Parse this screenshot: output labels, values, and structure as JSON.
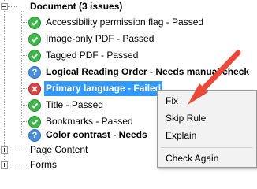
{
  "tree": {
    "root_partial_label": "s",
    "document_node": {
      "label": "Document (3 issues)",
      "expanded": true
    },
    "checks": [
      {
        "label": "Accessibility permission flag - Passed",
        "status": "passed",
        "bold": false
      },
      {
        "label": "Image-only PDF - Passed",
        "status": "passed",
        "bold": false
      },
      {
        "label": "Tagged PDF - Passed",
        "status": "passed",
        "bold": false
      },
      {
        "label": "Logical Reading Order - Needs manual check",
        "status": "needs-check",
        "bold": true
      },
      {
        "label": "Primary language - Failed",
        "status": "failed",
        "bold": true,
        "selected": true
      },
      {
        "label": "Title - Passed",
        "status": "passed",
        "bold": false
      },
      {
        "label": "Bookmarks - Passed",
        "status": "passed",
        "bold": false
      },
      {
        "label": "Color contrast - Needs",
        "status": "needs-check",
        "bold": true
      }
    ],
    "collapsed_nodes": [
      {
        "label": "Page Content"
      },
      {
        "label": "Forms"
      }
    ]
  },
  "context_menu": {
    "items": [
      "Fix",
      "Skip Rule",
      "Explain"
    ],
    "after_separator": [
      "Check Again"
    ]
  },
  "annotation": {
    "arrow_color": "#e8493a",
    "points_to": "Fix"
  },
  "colors": {
    "selection": "#3399ff",
    "passed": "#3db84a",
    "failed": "#d64541",
    "needs_check": "#4a90d9"
  },
  "icons": {
    "passed": "check-icon",
    "failed": "x-icon",
    "needs_check": "question-icon"
  }
}
